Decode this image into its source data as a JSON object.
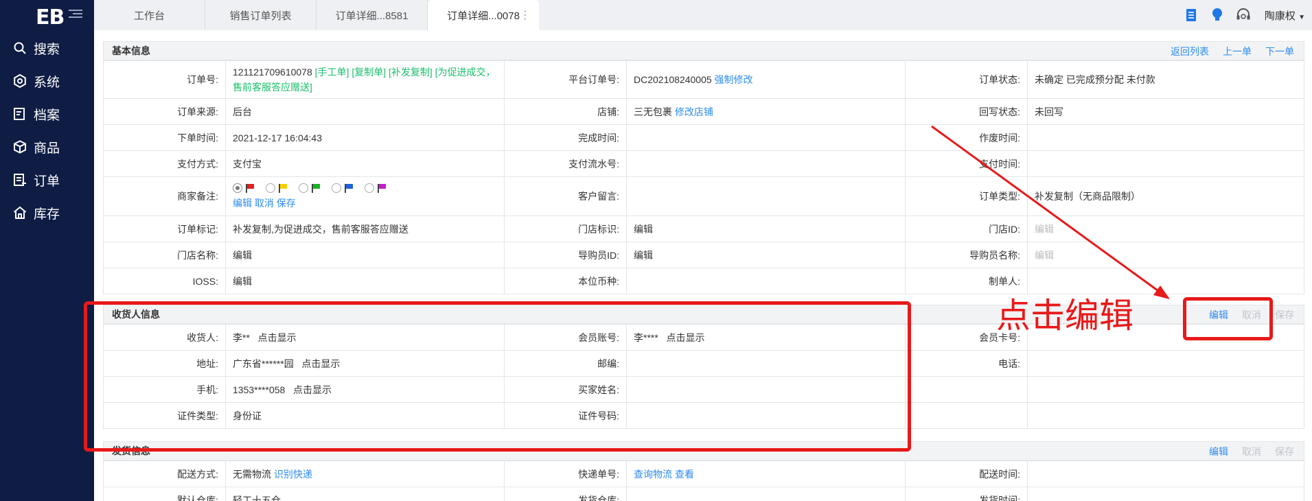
{
  "sidebar": {
    "logo": "EB",
    "items": [
      {
        "label": "搜索",
        "icon": "search-icon"
      },
      {
        "label": "系统",
        "icon": "gear-icon"
      },
      {
        "label": "档案",
        "icon": "archive-icon"
      },
      {
        "label": "商品",
        "icon": "box-icon"
      },
      {
        "label": "订单",
        "icon": "order-icon"
      },
      {
        "label": "库存",
        "icon": "warehouse-icon"
      }
    ]
  },
  "tabs": [
    {
      "label": "工作台"
    },
    {
      "label": "销售订单列表"
    },
    {
      "label": "订单详细...8581"
    },
    {
      "label": "订单详细...0078"
    }
  ],
  "topbar": {
    "user": "陶康权"
  },
  "basic": {
    "title": "基本信息",
    "actions": {
      "back": "返回列表",
      "prev": "上一单",
      "next": "下一单"
    },
    "order_no_label": "订单号:",
    "order_no": "121121709610078",
    "order_tags": "[手工单] [复制单] [补发复制] [为促进成交，售前客服答应赠送]",
    "platform_no_label": "平台订单号:",
    "platform_no": "DC202108240005",
    "force_modify": "强制修改",
    "status_label": "订单状态:",
    "status": "未确定 已完成预分配 未付款",
    "source_label": "订单来源:",
    "source": "后台",
    "shop_label": "店铺:",
    "shop": "三无包裹",
    "modify_shop": "修改店铺",
    "writeback_label": "回写状态:",
    "writeback": "未回写",
    "order_time_label": "下单时间:",
    "order_time": "2021-12-17 16:04:43",
    "finish_time_label": "完成时间:",
    "void_time_label": "作废时间:",
    "pay_method_label": "支付方式:",
    "pay_method": "支付宝",
    "pay_serial_label": "支付流水号:",
    "pay_time_label": "支付时间:",
    "merchant_note_label": "商家备注:",
    "note_edit": "编辑",
    "note_cancel": "取消",
    "note_save": "保存",
    "customer_msg_label": "客户留言:",
    "order_type_label": "订单类型:",
    "order_type": "补发复制（无商品限制）",
    "order_mark_label": "订单标记:",
    "order_mark": "补发复制,为促进成交，售前客服答应赠送",
    "store_mark_label": "门店标识:",
    "store_mark": "编辑",
    "store_id_label": "门店ID:",
    "store_id": "编辑",
    "store_name_label": "门店名称:",
    "store_name": "编辑",
    "guide_id_label": "导购员ID:",
    "guide_id": "编辑",
    "guide_name_label": "导购员名称:",
    "guide_name": "编辑",
    "ioss_label": "IOSS:",
    "ioss": "编辑",
    "currency_label": "本位币种:",
    "maker_label": "制单人:",
    "flag_colors": [
      "#e02020",
      "#f5d000",
      "#19b324",
      "#1e62d8",
      "#c21ec8"
    ]
  },
  "receiver": {
    "title": "收货人信息",
    "actions": {
      "edit": "编辑",
      "cancel": "取消",
      "save": "保存"
    },
    "name_label": "收货人:",
    "name": "李**",
    "reveal": "点击显示",
    "member_label": "会员账号:",
    "member": "李****",
    "card_label": "会员卡号:",
    "address_label": "地址:",
    "address": "广东省******园",
    "zip_label": "邮编:",
    "phone_label": "电话:",
    "mobile_label": "手机:",
    "mobile": "1353****058",
    "buyer_label": "买家姓名:",
    "id_type_label": "证件类型:",
    "id_type": "身份证",
    "id_no_label": "证件号码:"
  },
  "shipping": {
    "title": "发货信息",
    "actions": {
      "edit": "编辑",
      "cancel": "取消",
      "save": "保存"
    },
    "method_label": "配送方式:",
    "method": "无需物流",
    "identify": "识别快递",
    "tracking_label": "快递单号:",
    "query": "查询物流",
    "view": "查看",
    "ship_time_label": "配送时间:",
    "warehouse_label": "默认仓库:",
    "warehouse": "轻工十五仓",
    "send_warehouse_label": "发货仓库:",
    "send_time_label": "发货时间:"
  },
  "annotation": {
    "text": "点击编辑",
    "color": "#e81919"
  }
}
